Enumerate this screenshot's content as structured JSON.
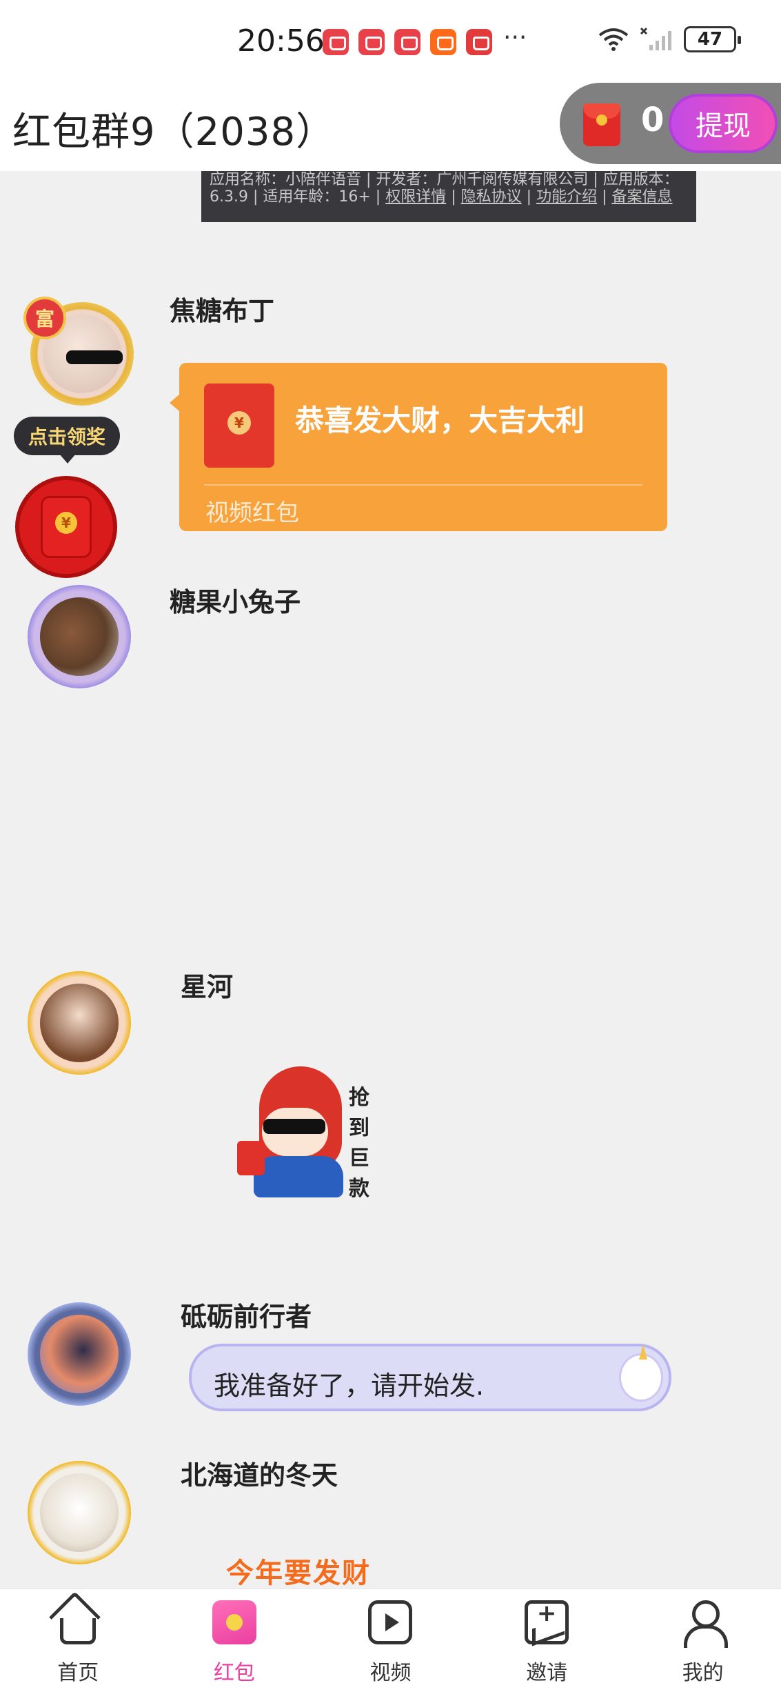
{
  "status_bar": {
    "time": "20:56",
    "notification_icons": [
      "huawei-mall-icon",
      "huawei-mall-icon",
      "huawei-mall-icon",
      "kuaishou-icon",
      "video-app-icon"
    ],
    "more": "···",
    "battery": "47"
  },
  "header": {
    "title": "红包群9（2038）",
    "wallet_count": "0",
    "withdraw_label": "提现"
  },
  "app_info": {
    "text": "应用名称：小陪伴语音 | 开发者：广州千阅传媒有限公司 | 应用版本：6.3.9 | 适用年龄：16+ |",
    "links": [
      "权限详情",
      "隐私协议",
      "功能介绍",
      "备案信息"
    ]
  },
  "messages": [
    {
      "sender": "焦糖布丁",
      "badge": "富",
      "type": "red_packet",
      "greeting": "恭喜发大财，大吉大利",
      "packet_type": "视频红包"
    },
    {
      "sender": "糖果小兔子",
      "type": "empty"
    },
    {
      "sender": "星河",
      "type": "sticker",
      "sticker_text": "抢到巨款"
    },
    {
      "sender": "砥砺前行者",
      "type": "text",
      "text": "我准备好了，请开始发."
    },
    {
      "sender": "北海道的冬天",
      "type": "sticker",
      "sticker_text": "今年要发财"
    }
  ],
  "floating_claim": {
    "label": "点击领奖"
  },
  "bottom_nav": [
    {
      "label": "首页",
      "icon": "home-icon",
      "active": false
    },
    {
      "label": "红包",
      "icon": "red-packet-icon",
      "active": true
    },
    {
      "label": "视频",
      "icon": "video-icon",
      "active": false
    },
    {
      "label": "邀请",
      "icon": "invite-icon",
      "active": false
    },
    {
      "label": "我的",
      "icon": "profile-icon",
      "active": false
    }
  ],
  "colors": {
    "accent": "#ea3fa0",
    "packet_orange": "#f7a23b",
    "bubble_lavender": "#dcdcf7",
    "background": "#f1f0f1"
  }
}
